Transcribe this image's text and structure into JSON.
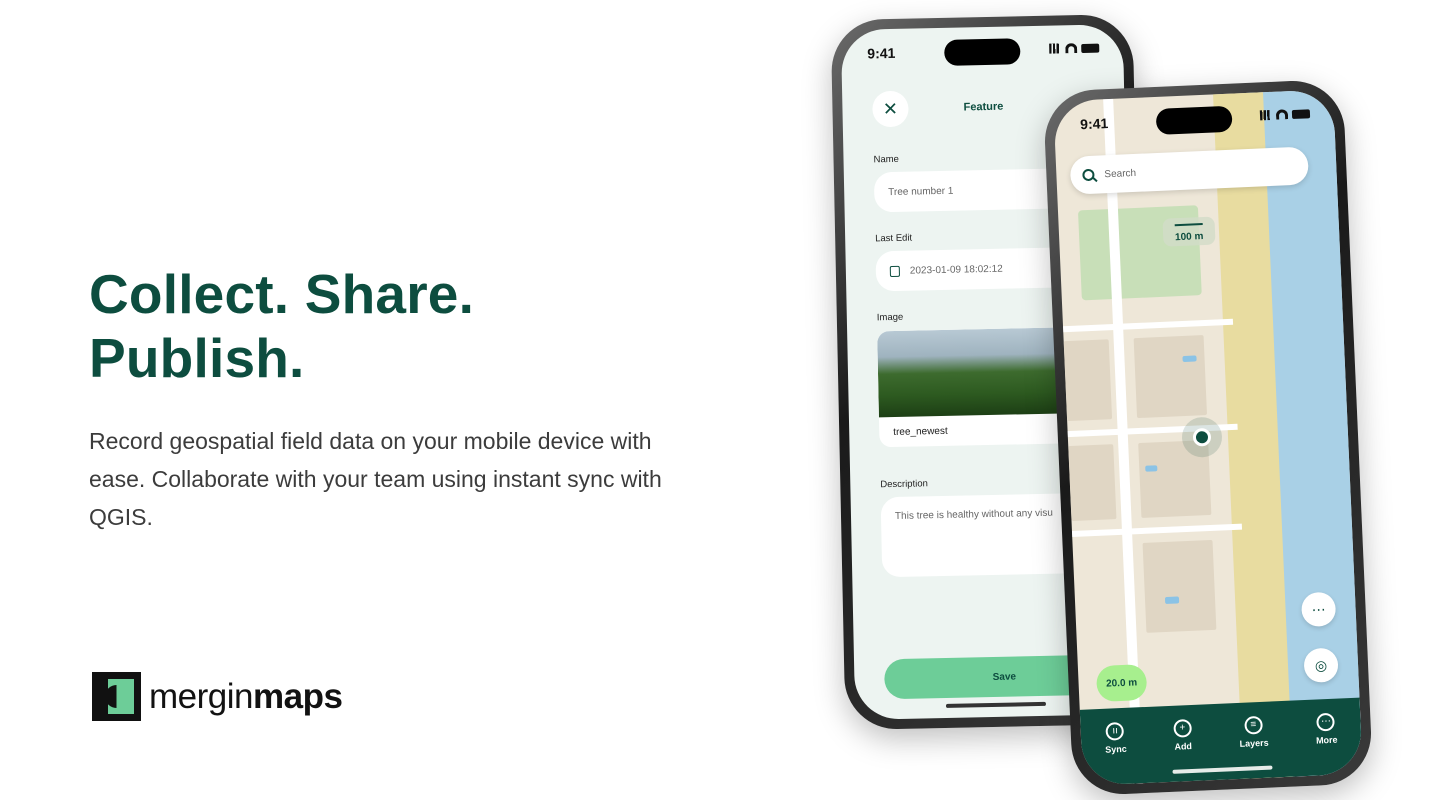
{
  "hero": {
    "title_line1": "Collect. Share.",
    "title_line2": "Publish.",
    "description": "Record geospatial field data on your mobile device with ease. Collaborate with your team using instant sync with QGIS."
  },
  "logo": {
    "light": "mergin",
    "bold": "maps"
  },
  "colors": {
    "brand": "#0d4d3f",
    "accent": "#6dcd98",
    "text": "#3c3c3c"
  },
  "phone_form": {
    "status_time": "9:41",
    "title": "Feature",
    "close_icon": "close-icon",
    "fields": {
      "name_label": "Name",
      "name_value": "Tree number 1",
      "last_edit_label": "Last Edit",
      "last_edit_value": "2023-01-09 18:02:12",
      "image_label": "Image",
      "image_name": "tree_newest",
      "description_label": "Description",
      "description_value": "This tree is healthy without any visu"
    },
    "save_label": "Save"
  },
  "phone_map": {
    "status_time": "9:41",
    "search_placeholder": "Search",
    "scale_label": "100 m",
    "accuracy_label": "20.0 m",
    "tabs": [
      {
        "label": "Sync",
        "icon": "sync-icon"
      },
      {
        "label": "Add",
        "icon": "add-icon"
      },
      {
        "label": "Layers",
        "icon": "layers-icon"
      },
      {
        "label": "More",
        "icon": "more-icon"
      }
    ]
  }
}
